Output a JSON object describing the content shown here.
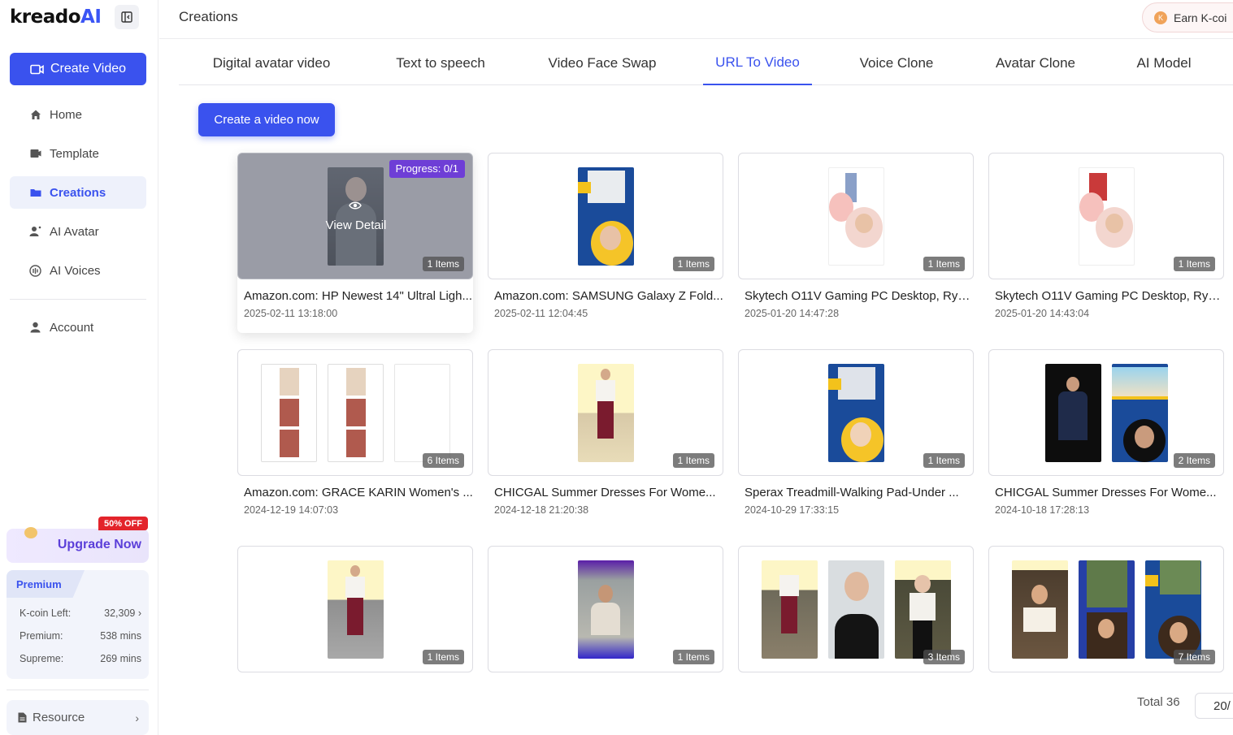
{
  "app": {
    "logo_main": "kreado",
    "logo_ai": "AI",
    "page_title": "Creations"
  },
  "sidebar": {
    "create_video": "Create Video",
    "items": [
      {
        "label": "Home",
        "icon": "home-icon"
      },
      {
        "label": "Template",
        "icon": "template-icon"
      },
      {
        "label": "Creations",
        "icon": "folder-icon",
        "active": true
      },
      {
        "label": "AI Avatar",
        "icon": "avatar-icon"
      },
      {
        "label": "AI Voices",
        "icon": "voice-icon"
      }
    ],
    "account": "Account",
    "upgrade": "Upgrade Now",
    "discount_badge": "50% OFF",
    "plan": {
      "name": "Premium",
      "rows": [
        {
          "label": "K-coin Left:",
          "value": "32,309 ›"
        },
        {
          "label": "Premium:",
          "value": "538 mins"
        },
        {
          "label": "Supreme:",
          "value": "269 mins"
        }
      ]
    },
    "resource": "Resource"
  },
  "header": {
    "earn": "Earn K-coi"
  },
  "tabs": [
    {
      "label": "Digital avatar video"
    },
    {
      "label": "Text to speech"
    },
    {
      "label": "Video Face Swap"
    },
    {
      "label": "URL To Video",
      "active": true
    },
    {
      "label": "Voice Clone"
    },
    {
      "label": "Avatar Clone"
    },
    {
      "label": "AI Model"
    }
  ],
  "cta": "Create a video now",
  "cards": [
    {
      "title": "Amazon.com: HP Newest 14\" Ultral Ligh...",
      "date": "2025-02-11 13:18:00",
      "items": "1 Items",
      "progress": "Progress: 0/1",
      "view_detail": "View Detail"
    },
    {
      "title": "Amazon.com: SAMSUNG Galaxy Z Fold...",
      "date": "2025-02-11 12:04:45",
      "items": "1 Items"
    },
    {
      "title": "Skytech O11V Gaming PC Desktop, Ryz...",
      "date": "2025-01-20 14:47:28",
      "items": "1 Items"
    },
    {
      "title": "Skytech O11V Gaming PC Desktop, Ryz...",
      "date": "2025-01-20 14:43:04",
      "items": "1 Items"
    },
    {
      "title": "Amazon.com: GRACE KARIN Women's ...",
      "date": "2024-12-19 14:07:03",
      "items": "6 Items"
    },
    {
      "title": "CHICGAL Summer Dresses For Wome...",
      "date": "2024-12-18 21:20:38",
      "items": "1 Items"
    },
    {
      "title": "Sperax Treadmill-Walking Pad-Under ...",
      "date": "2024-10-29 17:33:15",
      "items": "1 Items"
    },
    {
      "title": "CHICGAL Summer Dresses For Wome...",
      "date": "2024-10-18 17:28:13",
      "items": "2 Items"
    },
    {
      "title": "",
      "date": "",
      "items": "1 Items"
    },
    {
      "title": "",
      "date": "",
      "items": "1 Items"
    },
    {
      "title": "",
      "date": "",
      "items": "3 Items"
    },
    {
      "title": "",
      "date": "",
      "items": "7 Items"
    }
  ],
  "footer": {
    "total": "Total 36",
    "page_size": "20/"
  },
  "colors": {
    "accent": "#3a52ee",
    "progress": "#6e3ed6",
    "discount": "#e3242b"
  }
}
